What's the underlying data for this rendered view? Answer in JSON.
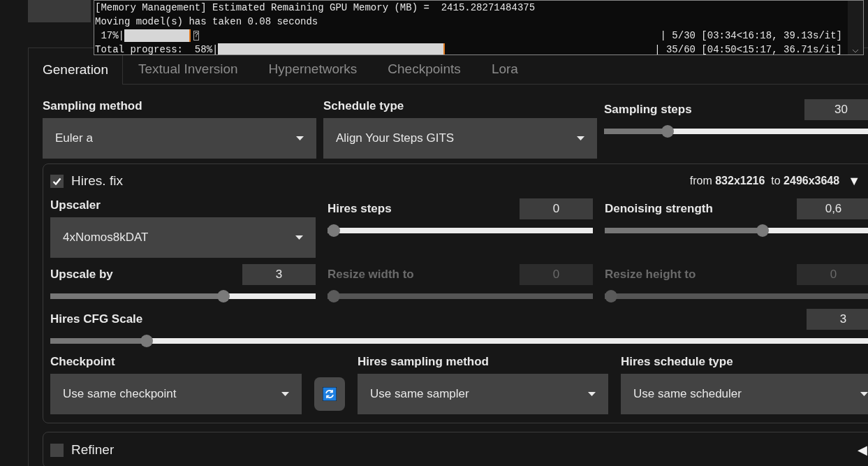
{
  "console": {
    "lines": [
      "[Memory Management] Estimated Remaining GPU Memory (MB) =  2415.28271484375",
      "Moving model(s) has taken 0.08 seconds"
    ],
    "progress": [
      {
        "label": " 17%|",
        "level": 0.17,
        "tail": "?",
        "stats": "| 5/30 [03:34<16:18, 39.13s/it]"
      },
      {
        "label": "Total progress:  58%|",
        "level": 0.58,
        "stats": "| 35/60 [04:50<15:17, 36.71s/it]"
      }
    ]
  },
  "tabs": [
    {
      "label": "Generation",
      "selected": true
    },
    {
      "label": "Textual Inversion",
      "selected": false
    },
    {
      "label": "Hypernetworks",
      "selected": false
    },
    {
      "label": "Checkpoints",
      "selected": false
    },
    {
      "label": "Lora",
      "selected": false
    }
  ],
  "sampling": [
    {
      "kind": "dropdown",
      "label": "Sampling method",
      "value": "Euler a"
    },
    {
      "kind": "dropdown",
      "label": "Schedule type",
      "value": "Align Your Steps GITS"
    },
    {
      "kind": "slider",
      "label": "Sampling steps",
      "value": "30",
      "level": 0.22,
      "disabled": false
    }
  ],
  "hires_fix": {
    "label": "Hires. fix",
    "checked": true,
    "summary": "from **832x1216**  to **2496x3648**",
    "toggle": "▼",
    "grid": [
      {
        "kind": "dropdown",
        "label": "Upscaler",
        "value": "4xNomos8kDAT"
      },
      {
        "kind": "slider",
        "label": "Hires steps",
        "value": "0",
        "level": 0,
        "disabled": false
      },
      {
        "kind": "slider",
        "label": "Denoising strength",
        "value": "0,6",
        "level": 0.6,
        "disabled": false
      },
      {
        "kind": "slider",
        "label": "Upscale by",
        "value": "3",
        "level": 0.66,
        "disabled": false
      },
      {
        "kind": "slider",
        "label": "Resize width to",
        "value": "0",
        "level": 0,
        "disabled": true
      },
      {
        "kind": "slider",
        "label": "Resize height to",
        "value": "0",
        "level": 0,
        "disabled": true
      }
    ],
    "cfg": {
      "kind": "slider",
      "label": "Hires CFG Scale",
      "value": "3",
      "level": 0.11,
      "disabled": false
    },
    "bottom": [
      {
        "kind": "dropdown",
        "label": "Checkpoint",
        "value": "Use same checkpoint"
      },
      {
        "kind": "refresh"
      },
      {
        "kind": "dropdown",
        "label": "Hires sampling method",
        "value": "Use same sampler"
      },
      {
        "kind": "dropdown",
        "label": "Hires schedule type",
        "value": "Use same scheduler"
      }
    ]
  },
  "refiner": {
    "label": "Refiner",
    "checked": false,
    "toggle": "◀"
  }
}
